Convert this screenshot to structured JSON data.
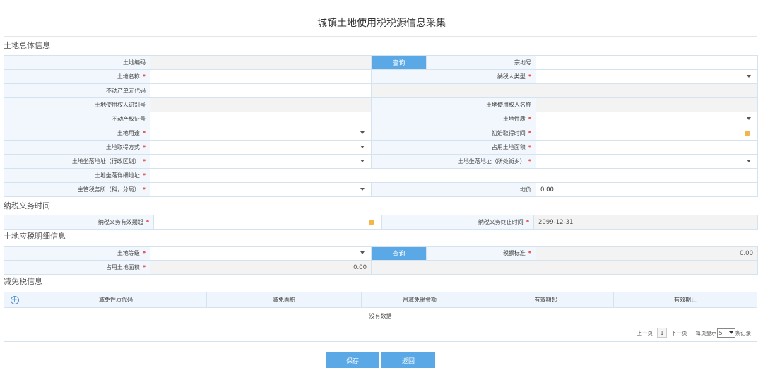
{
  "page_title": "城镇土地使用税税源信息采集",
  "sections": {
    "general": "土地总体信息",
    "obligation": "纳税义务时间",
    "detail": "土地应税明细信息",
    "relief": "减免税信息"
  },
  "general": {
    "land_code": "土地编码",
    "query": "查询",
    "parcel_no": "宗地号",
    "land_name": "土地名称",
    "taxpayer_type": "纳税人类型",
    "estate_unit_code": "不动产单元代码",
    "user_id": "土地使用权人识别号",
    "user_name": "土地使用权人名称",
    "cert_no": "不动产权证号",
    "land_nature": "土地性质",
    "land_use": "土地用途",
    "acquire_time": "初始取得时间",
    "acquire_method": "土地取得方式",
    "occupied_area": "占用土地面积",
    "addr_district": "土地坐落地址（行政区划）",
    "addr_street": "土地坐落地址（所处街乡）",
    "addr_detail": "土地坐落详细地址",
    "tax_office": "主管税务所（科，分局）",
    "land_price": "地价",
    "land_price_value": "0.00"
  },
  "obligation": {
    "start": "纳税义务有效期起",
    "end": "纳税义务终止时间",
    "end_value": "2099-12-31"
  },
  "detail": {
    "grade": "土地等级",
    "query": "查询",
    "tax_standard": "税额标准",
    "tax_standard_value": "0.00",
    "area": "占用土地面积",
    "area_value": "0.00"
  },
  "relief": {
    "plus": "+",
    "columns": [
      "减免性质代码",
      "减免面积",
      "月减免税金额",
      "有效期起",
      "有效期止"
    ],
    "empty": "没有数据",
    "pager": {
      "prev": "上一页",
      "page": "1",
      "next": "下一页",
      "per_page": "每页显示",
      "size": "5",
      "suffix": "条记录"
    }
  },
  "buttons": {
    "save": "保存",
    "back": "返回"
  },
  "required_mark": "*"
}
